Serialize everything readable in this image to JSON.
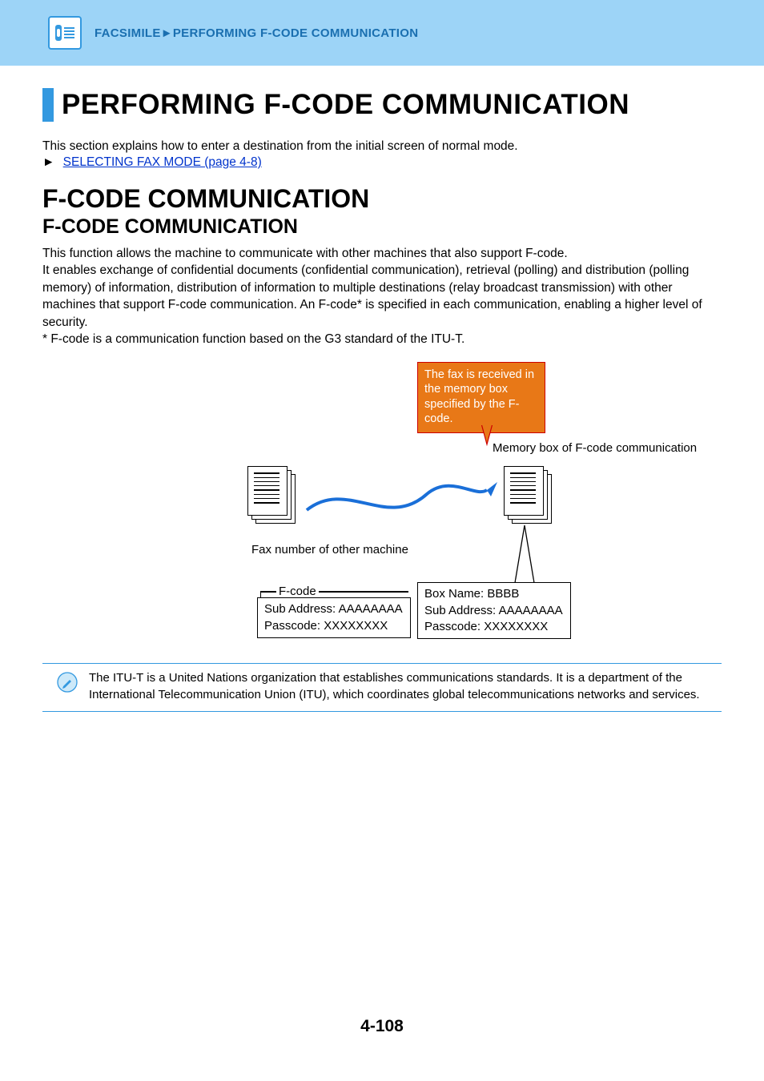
{
  "breadcrumb": "FACSIMILE►PERFORMING F-CODE COMMUNICATION",
  "mainTitle": "PERFORMING F-CODE COMMUNICATION",
  "introText": "This section explains how to enter a destination from the initial screen of normal mode.",
  "linkText": "SELECTING FAX MODE (page 4-8)",
  "sectionTitle": "F-CODE COMMUNICATION",
  "subTitle": "F-CODE COMMUNICATION",
  "bodyText": "This function allows the machine to communicate with other machines that also support F-code.\nIt enables exchange of confidential documents (confidential communication), retrieval (polling) and distribution (polling memory) of information, distribution of information to multiple destinations (relay broadcast transmission) with other machines that support F-code communication. An F-code* is specified in each communication, enabling a higher level of security.\n* F-code is a communication function based on the G3 standard of the ITU-T.",
  "diagram": {
    "calloutText": "The fax is received in the memory box specified by the F-code.",
    "memLabel": "Memory box of F-code communication",
    "faxLabel": "Fax number of other machine",
    "fcodeLabel": "F-code",
    "box1_line1": "Sub Address: AAAAAAAA",
    "box1_line2": "Passcode: XXXXXXXX",
    "box2_line1": "Box Name: BBBB",
    "box2_line2": "Sub Address: AAAAAAAA",
    "box2_line3": "Passcode: XXXXXXXX"
  },
  "noteText": "The ITU-T is a United Nations organization that establishes communications standards. It is a department of the International Telecommunication Union (ITU), which coordinates global telecommunications networks and services.",
  "pageNum": "4-108"
}
